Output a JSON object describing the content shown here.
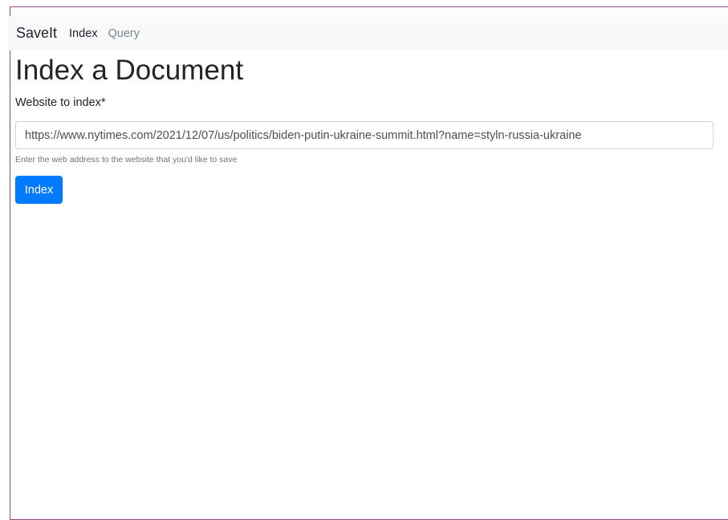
{
  "navbar": {
    "brand": "SaveIt",
    "links": [
      {
        "label": "Index",
        "active": true
      },
      {
        "label": "Query",
        "active": false
      }
    ]
  },
  "main": {
    "title": "Index a Document",
    "form": {
      "url_label": "Website to index*",
      "url_value": "https://www.nytimes.com/2021/12/07/us/politics/biden-putin-ukraine-summit.html?name=styln-russia-ukraine",
      "help_text": "Enter the web address to the website that you'd like to save",
      "submit_label": "Index"
    }
  },
  "colors": {
    "accent": "#007bff",
    "navbar_bg": "#f8f9fa",
    "frame_border": "#8e4c86"
  }
}
